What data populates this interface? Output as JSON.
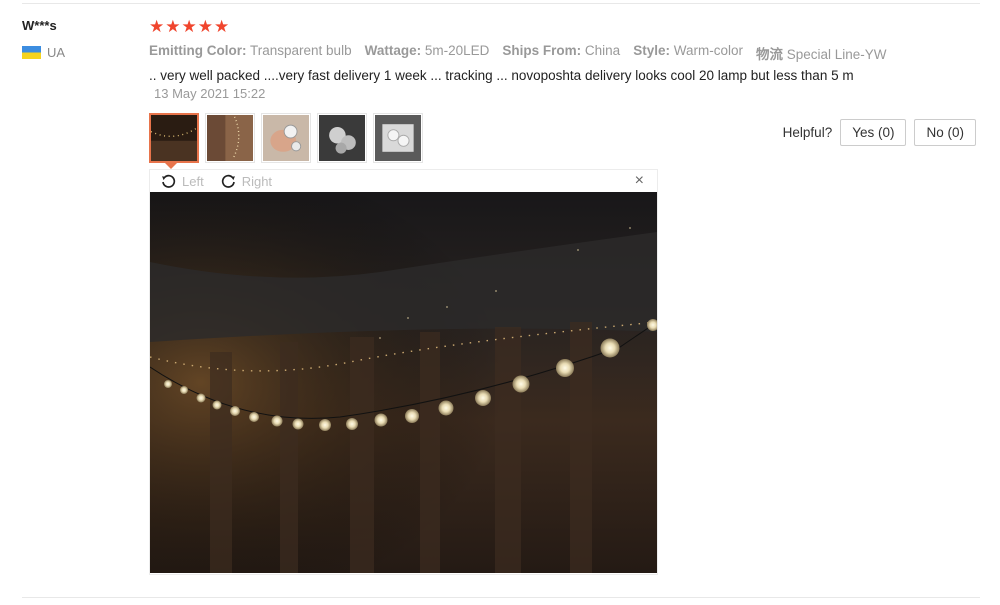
{
  "review": {
    "user": "W***s",
    "country": "UA",
    "stars": [
      "★",
      "★",
      "★",
      "★",
      "★"
    ],
    "attributes": [
      {
        "key": "Emitting Color:",
        "value": "Transparent bulb"
      },
      {
        "key": "Wattage:",
        "value": "5m-20LED"
      },
      {
        "key": "Ships From:",
        "value": "China"
      },
      {
        "key": "Style:",
        "value": "Warm-color"
      },
      {
        "key": "物流",
        "value": "Special Line-YW"
      }
    ],
    "text": ".. very well packed ....very fast delivery 1 week ... tracking ... novoposhta delivery looks cool 20 lamp but less than 5 m",
    "date": "13 May 2021 15:22",
    "helpful": {
      "label": "Helpful?",
      "yes": "Yes (0)",
      "no": "No (0)"
    },
    "viewer": {
      "left": "Left",
      "right": "Right",
      "close": "×"
    }
  },
  "colors": {
    "star": "#f0452d",
    "active_border": "#e8744b"
  }
}
